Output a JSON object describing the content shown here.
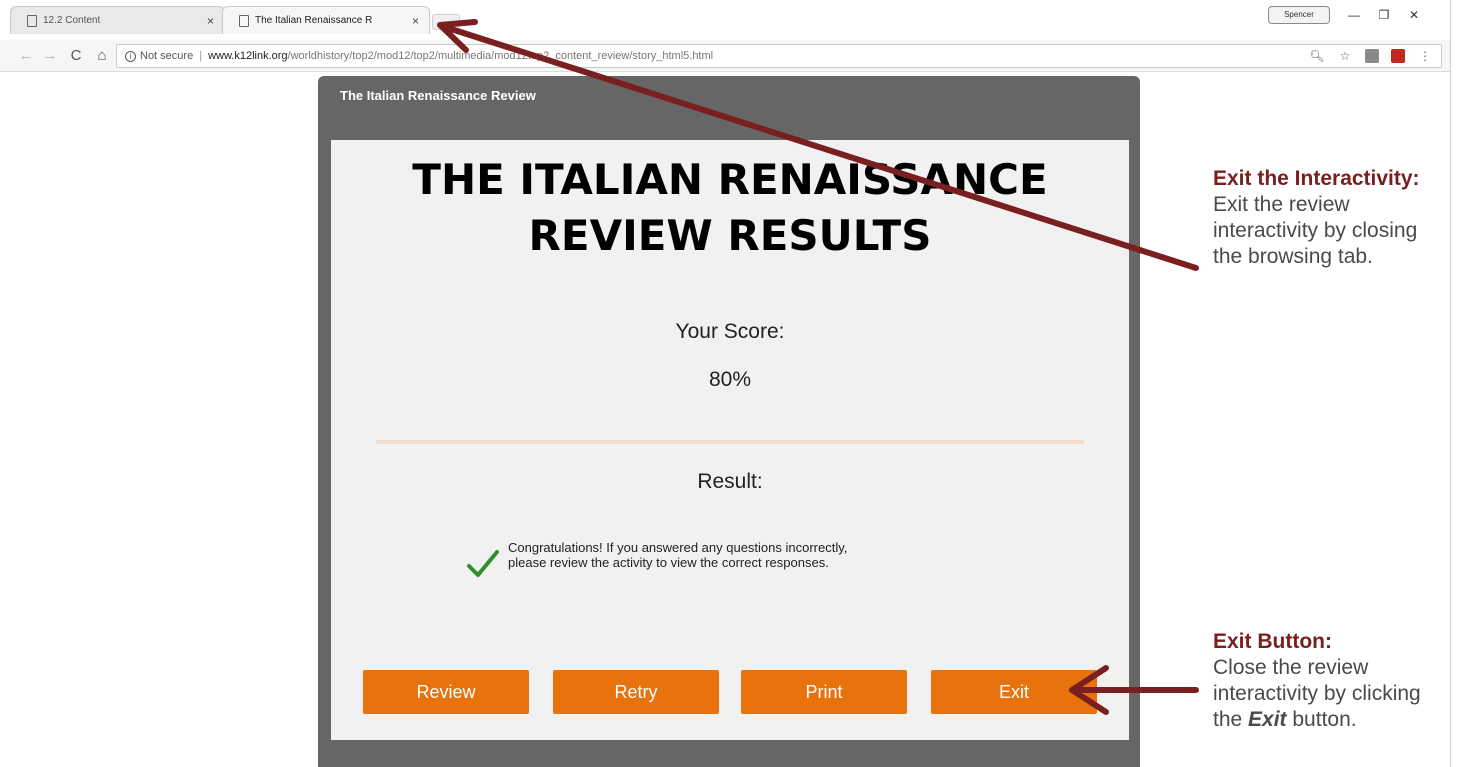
{
  "browser": {
    "tabs": [
      {
        "title": "12.2 Content",
        "close": "×"
      },
      {
        "title": "The Italian Renaissance R",
        "close": "×"
      }
    ],
    "window_user": "Spencer",
    "window_controls": {
      "minimize": "—",
      "maximize": "❐",
      "close": "✕"
    },
    "nav": {
      "back": "←",
      "forward": "→",
      "reload": "C",
      "home": "⌂"
    },
    "address": {
      "security_label": "Not secure",
      "separator": "|",
      "host": "www.k12link.org",
      "path": "/worldhistory/top2/mod12/top2/multimedia/mod12top2_content_review/story_html5.html"
    },
    "toolbar_icons": [
      "zoom-icon",
      "star-icon",
      "extension-icon",
      "pdf-icon",
      "menu-icon"
    ]
  },
  "player": {
    "title": "The Italian Renaissance Review"
  },
  "slide": {
    "heading_line1": "THE ITALIAN RENAISSANCE",
    "heading_line2": "REVIEW RESULTS",
    "score_label": "Your Score:",
    "score_value": "80%",
    "result_label": "Result:",
    "result_text_line1": "Congratulations! If you answered any questions incorrectly,",
    "result_text_line2": "please review the activity to view the correct responses.",
    "buttons": {
      "review": "Review",
      "retry": "Retry",
      "print": "Print",
      "exit": "Exit"
    }
  },
  "annotations": {
    "exit_interactivity": {
      "title": "Exit the Interactivity:",
      "body_line1": "Exit the review",
      "body_line2": "interactivity by closing",
      "body_line3": "the browsing tab."
    },
    "exit_button": {
      "title": "Exit Button:",
      "body_line1": "Close the review",
      "body_line2": "interactivity by clicking",
      "body_line3_prefix": "the ",
      "body_line3_emph": "Exit",
      "body_line3_suffix": " button."
    }
  },
  "colors": {
    "accent_orange": "#e8720c",
    "player_gray": "#666666",
    "annotation_maroon": "#7a1f1f",
    "check_green": "#2f8f2f"
  }
}
